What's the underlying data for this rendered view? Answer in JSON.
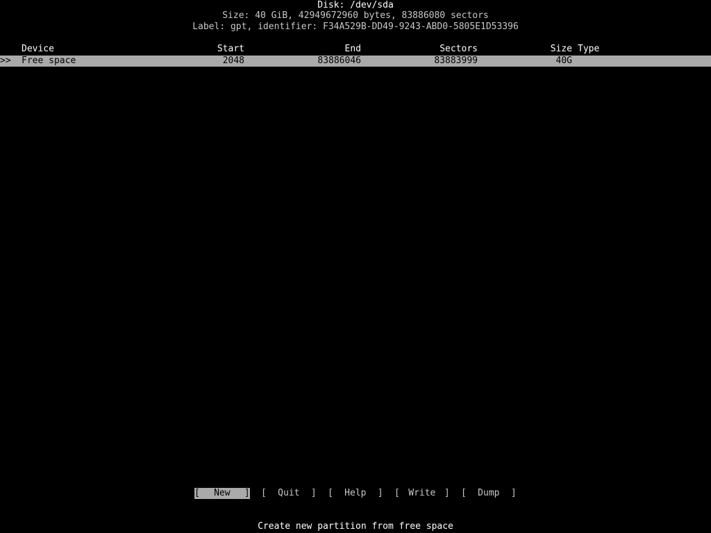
{
  "disk": {
    "title": "Disk: /dev/sda",
    "size_line": "Size: 40 GiB, 42949672960 bytes, 83886080 sectors",
    "label_line": "Label: gpt, identifier: F34A529B-DD49-9243-ABD0-5805E1D53396"
  },
  "table": {
    "headers": {
      "device": "Device",
      "start": "Start",
      "end": "End",
      "sectors": "Sectors",
      "size": "Size",
      "type": "Type"
    },
    "rows": [
      {
        "marker": ">>",
        "device": "Free space",
        "start": "2048",
        "end": "83886046",
        "sectors": "83883999",
        "size": "40G",
        "type": ""
      }
    ]
  },
  "menu": {
    "items": [
      {
        "open": "[",
        "label": "New",
        "close": "]"
      },
      {
        "open": "[",
        "label": "Quit",
        "close": "]"
      },
      {
        "open": "[",
        "label": "Help",
        "close": "]"
      },
      {
        "open": "[",
        "label": "Write",
        "close": "]"
      },
      {
        "open": "[",
        "label": "Dump",
        "close": "]"
      }
    ],
    "selected_index": 0
  },
  "hint": "Create new partition from free space",
  "colors": {
    "background": "#000000",
    "text": "#ffffff",
    "highlight_bg": "#aaaaaa",
    "highlight_text": "#000000"
  }
}
